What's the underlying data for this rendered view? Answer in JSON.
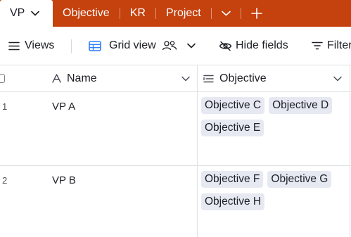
{
  "tabs": {
    "active_label": "VP",
    "items": [
      {
        "label": "Objective"
      },
      {
        "label": "KR"
      },
      {
        "label": "Project"
      }
    ]
  },
  "toolbar": {
    "views_label": "Views",
    "grid_view_label": "Grid view",
    "hide_fields_label": "Hide fields",
    "filter_label": "Filter"
  },
  "columns": {
    "name": "Name",
    "objective": "Objective"
  },
  "rows": [
    {
      "number": "1",
      "name": "VP A",
      "objectives": [
        "Objective C",
        "Objective D",
        "Objective E"
      ]
    },
    {
      "number": "2",
      "name": "VP B",
      "objectives": [
        "Objective F",
        "Objective G",
        "Objective H"
      ]
    }
  ],
  "colors": {
    "tabbar": "#c5410e",
    "chip": "#e6e9f2",
    "grid_icon": "#2d7ff9"
  },
  "icons": [
    "chevron-down-icon",
    "plus-icon",
    "hamburger-icon",
    "grid-view-icon",
    "collaborators-icon",
    "eye-slash-icon",
    "filter-icon",
    "text-field-icon",
    "linked-record-icon"
  ]
}
